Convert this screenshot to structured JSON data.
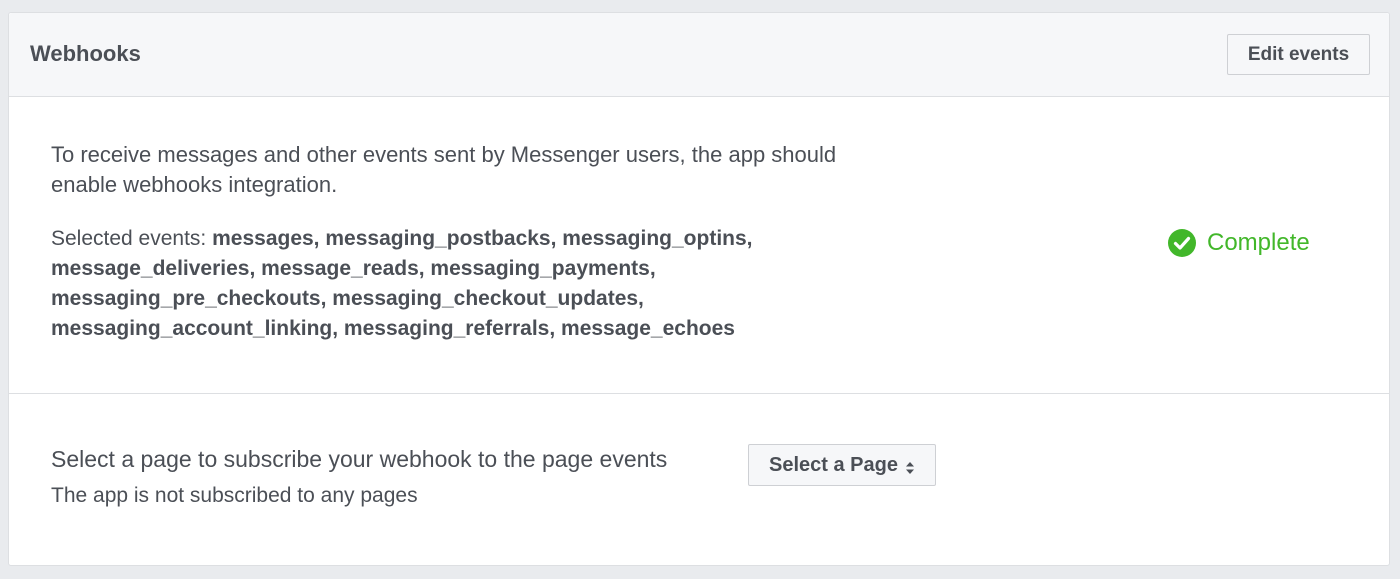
{
  "header": {
    "title": "Webhooks",
    "edit_events_label": "Edit events"
  },
  "webhooks_section": {
    "intro": "To receive messages and other events sent by Messenger users, the app should enable webhooks integration.",
    "selected_events_label": "Selected events:",
    "selected_events": "messages, messaging_postbacks, messaging_optins, message_deliveries, message_reads, messaging_payments, messaging_pre_checkouts, messaging_checkout_updates, messaging_account_linking, messaging_referrals, message_echoes",
    "status": {
      "label": "Complete",
      "icon": "check-circle-icon",
      "color": "#42b72a"
    }
  },
  "subscription_section": {
    "instruction": "Select a page to subscribe your webhook to the page events",
    "status_text": "The app is not subscribed to any pages",
    "select_page_label": "Select a Page",
    "select_page_icon": "updown-chevron-icon"
  }
}
